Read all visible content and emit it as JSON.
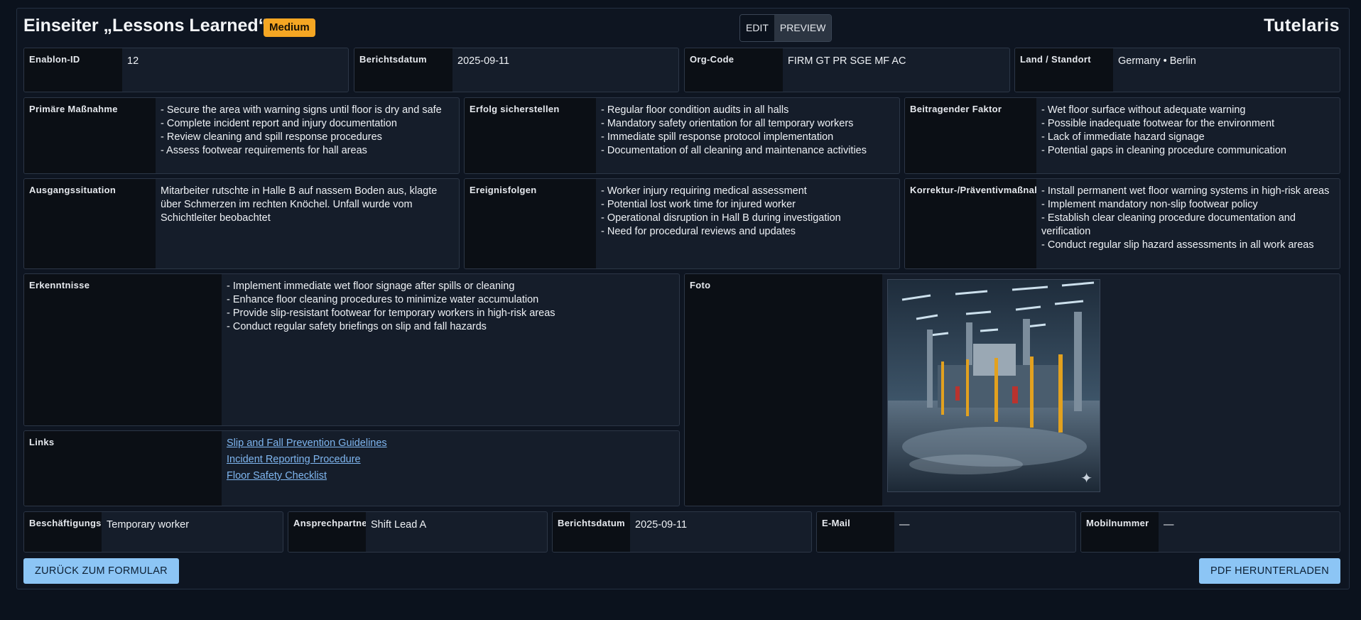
{
  "header": {
    "title": "Einseiter „Lessons Learned“",
    "badge": "Medium",
    "mode_edit": "EDIT",
    "mode_preview": "PREVIEW",
    "logo": "Tutelaris"
  },
  "top_fields": [
    {
      "label": "Enablon-ID",
      "value": "12"
    },
    {
      "label": "Berichtsdatum",
      "value": "2025-09-11"
    },
    {
      "label": "Org-Code",
      "value": "FIRM GT PR SGE MF AC"
    },
    {
      "label": "Land / Standort",
      "value": "Germany • Berlin"
    }
  ],
  "row2": [
    {
      "label": "Primäre Maßnahme",
      "lines": [
        "- Secure the area with warning signs until floor is dry and safe",
        "- Complete incident report and injury documentation",
        "- Review cleaning and spill response procedures",
        "- Assess footwear requirements for hall areas"
      ]
    },
    {
      "label": "Erfolg sicherstellen",
      "lines": [
        "- Regular floor condition audits in all halls",
        "- Mandatory safety orientation for all temporary workers",
        "- Immediate spill response protocol implementation",
        "- Documentation of all cleaning and maintenance activities"
      ]
    },
    {
      "label": "Beitragender Faktor",
      "lines": [
        "- Wet floor surface without adequate warning",
        "- Possible inadequate footwear for the environment",
        "- Lack of immediate hazard signage",
        "- Potential gaps in cleaning procedure communication"
      ]
    }
  ],
  "row3": [
    {
      "label": "Ausgangssituation",
      "lines": [
        "Mitarbeiter rutschte in Halle B auf nassem Boden aus, klagte über Schmerzen im rechten Knöchel. Unfall wurde vom Schichtleiter beobachtet"
      ]
    },
    {
      "label": "Ereignisfolgen",
      "lines": [
        "- Worker injury requiring medical assessment",
        "- Potential lost work time for injured worker",
        "- Operational disruption in Hall B during investigation",
        "- Need for procedural reviews and updates"
      ]
    },
    {
      "label": "Korrektur-/Präventivmaßnahmen",
      "lines": [
        "- Install permanent wet floor warning systems in high-risk areas",
        "- Implement mandatory non-slip footwear policy",
        "- Establish clear cleaning procedure documentation and verification",
        "- Conduct regular slip hazard assessments in all work areas"
      ]
    }
  ],
  "erkenntnisse": {
    "label": "Erkenntnisse",
    "lines": [
      "- Implement immediate wet floor signage after spills or cleaning",
      "- Enhance floor cleaning procedures to minimize water accumulation",
      "- Provide slip-resistant footwear for temporary workers in high-risk areas",
      "- Conduct regular safety briefings on slip and fall hazards"
    ]
  },
  "links": {
    "label": "Links",
    "items": [
      "Slip and Fall Prevention Guidelines",
      "Incident Reporting Procedure",
      "Floor Safety Checklist"
    ]
  },
  "foto": {
    "label": "Foto"
  },
  "bottom_fields": [
    {
      "label": "Beschäftigungsverhältnis",
      "value": "Temporary worker"
    },
    {
      "label": "Ansprechpartner",
      "value": "Shift Lead A"
    },
    {
      "label": "Berichtsdatum",
      "value": "2025-09-11"
    },
    {
      "label": "E-Mail",
      "value": "—"
    },
    {
      "label": "Mobilnummer",
      "value": "—"
    }
  ],
  "actions": {
    "back": "ZURÜCK ZUM FORMULAR",
    "pdf": "PDF HERUNTERLADEN"
  },
  "colors": {
    "badge": "#f5a623",
    "button": "#8cc5f5",
    "link": "#7fb6f0"
  }
}
